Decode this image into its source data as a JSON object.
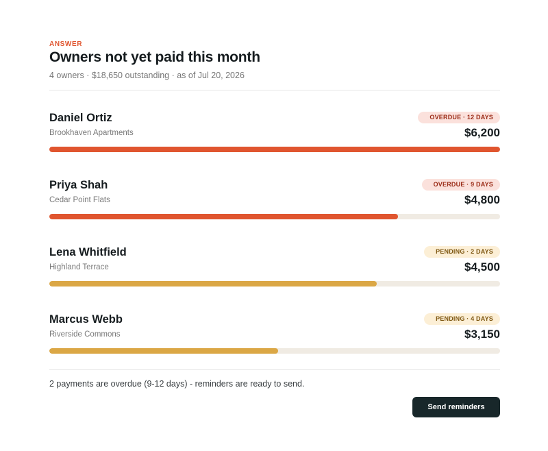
{
  "header": {
    "eyebrow": "ANSWER",
    "title": "Owners not yet paid this month",
    "subtitle": "4 owners · $18,650 outstanding · as of Jul 20, 2026"
  },
  "owners": [
    {
      "name": "Daniel Ortiz",
      "property": "Brookhaven Apartments",
      "status": "overdue",
      "badge": "OVERDUE · 12 DAYS",
      "amount": "$6,200",
      "value": 6200
    },
    {
      "name": "Priya Shah",
      "property": "Cedar Point Flats",
      "status": "overdue",
      "badge": "OVERDUE · 9 DAYS",
      "amount": "$4,800",
      "value": 4800
    },
    {
      "name": "Lena Whitfield",
      "property": "Highland Terrace",
      "status": "pending",
      "badge": "PENDING · 2 DAYS",
      "amount": "$4,500",
      "value": 4500
    },
    {
      "name": "Marcus Webb",
      "property": "Riverside Commons",
      "status": "pending",
      "badge": "PENDING · 4 DAYS",
      "amount": "$3,150",
      "value": 3150
    }
  ],
  "bar_max": 6200,
  "footer": {
    "note": "2 payments are overdue (9-12 days) - reminders are ready to send.",
    "button_label": "Send reminders"
  },
  "colors": {
    "accent": "#e0552f",
    "overdue_bar": "#e0552f",
    "pending_bar": "#dba745",
    "track": "#f0ebe3",
    "button": "#18272a"
  }
}
